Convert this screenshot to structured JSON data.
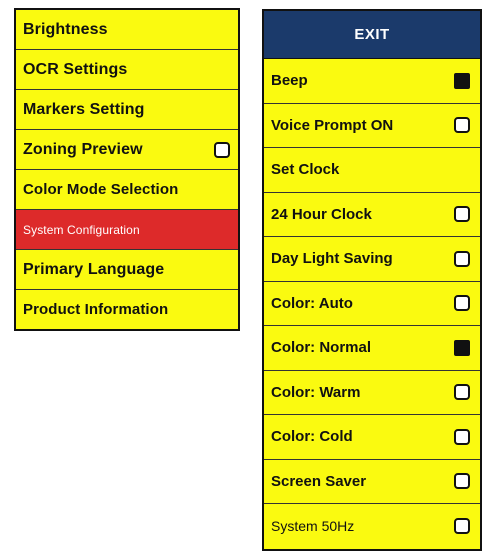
{
  "left_menu": {
    "items": [
      {
        "label": "Brightness"
      },
      {
        "label": "OCR Settings"
      },
      {
        "label": "Markers Setting"
      },
      {
        "label": "Zoning Preview",
        "checked": false
      },
      {
        "label": "Color Mode Selection"
      },
      {
        "label": "System Configuration",
        "selected": true
      },
      {
        "label": "Primary Language"
      },
      {
        "label": "Product Information"
      }
    ]
  },
  "right_menu": {
    "header": "EXIT",
    "items": [
      {
        "label": "Beep",
        "checked": true
      },
      {
        "label": "Voice Prompt ON",
        "checked": false
      },
      {
        "label": "Set Clock"
      },
      {
        "label": "24 Hour Clock",
        "checked": false
      },
      {
        "label": "Day Light Saving",
        "checked": false
      },
      {
        "label": "Color: Auto",
        "checked": false
      },
      {
        "label": "Color: Normal",
        "checked": true
      },
      {
        "label": "Color: Warm",
        "checked": false
      },
      {
        "label": "Color: Cold",
        "checked": false
      },
      {
        "label": "Screen Saver",
        "checked": false
      },
      {
        "label": "System 50Hz",
        "checked": false
      }
    ]
  },
  "colors": {
    "menu_background": "#fafa10",
    "selected_background": "#dd2a2a",
    "header_background": "#1b3a6b"
  }
}
